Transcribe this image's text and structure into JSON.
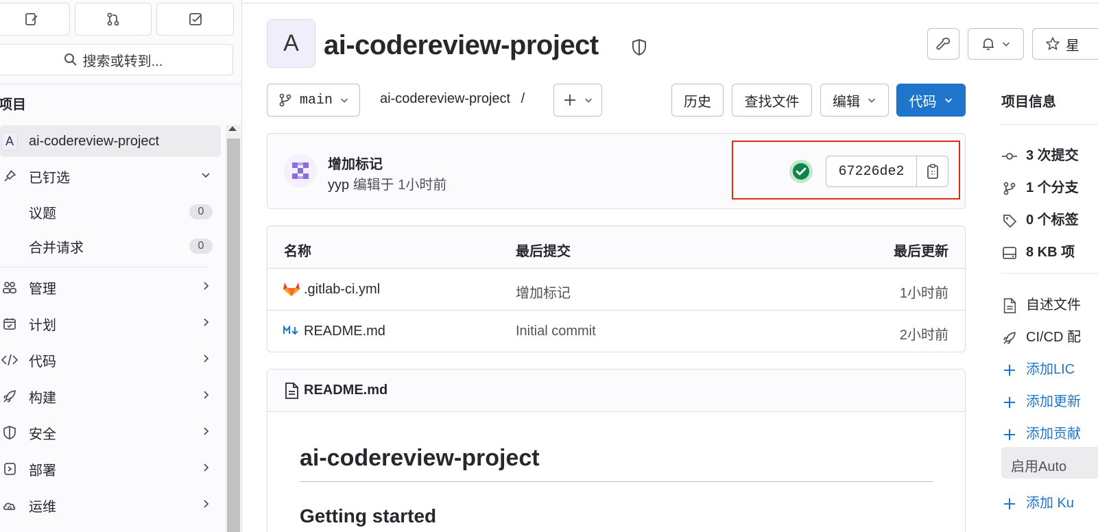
{
  "sidebar": {
    "search_label": "搜索或转到...",
    "section_title": "项目",
    "project_initial": "A",
    "project_name": "ai-codereview-project",
    "pinned_label": "已钉选",
    "issues_label": "议题",
    "issues_count": "0",
    "mr_label": "合并请求",
    "mr_count": "0",
    "menu": [
      {
        "label": "管理"
      },
      {
        "label": "计划"
      },
      {
        "label": "代码"
      },
      {
        "label": "构建"
      },
      {
        "label": "安全"
      },
      {
        "label": "部署"
      },
      {
        "label": "运维"
      }
    ]
  },
  "header": {
    "project_initial": "A",
    "project_title": "ai-codereview-project",
    "star_label": "星"
  },
  "toolbar": {
    "branch": "main",
    "breadcrumb_project": "ai-codereview-project",
    "breadcrumb_sep": "/",
    "history_label": "历史",
    "find_file_label": "查找文件",
    "edit_label": "编辑",
    "code_label": "代码"
  },
  "commit": {
    "title": "增加标记",
    "author": "yyp",
    "meta": "编辑于 1小时前",
    "sha": "67226de2"
  },
  "files": {
    "headers": {
      "name": "名称",
      "last_commit": "最后提交",
      "last_update": "最后更新"
    },
    "rows": [
      {
        "name": ".gitlab-ci.yml",
        "commit": "增加标记",
        "updated": "1小时前"
      },
      {
        "name": "README.md",
        "commit": "Initial commit",
        "updated": "2小时前"
      }
    ]
  },
  "readme": {
    "filename": "README.md",
    "heading": "ai-codereview-project",
    "subheading": "Getting started"
  },
  "info_panel": {
    "title": "项目信息",
    "commits": "3 次提交",
    "branches": "1 个分支",
    "tags": "0 个标签",
    "size": "8 KB 项",
    "readme": "自述文件",
    "cicd": "CI/CD 配",
    "add_license": "添加LIC",
    "add_changelog": "添加更新",
    "add_contrib": "添加贡献",
    "auto_devops": "启用Auto",
    "add_k8s": "添加 Ku"
  },
  "colors": {
    "primary": "#1f75cb",
    "success": "#108548",
    "highlight": "#dd2b0e"
  }
}
